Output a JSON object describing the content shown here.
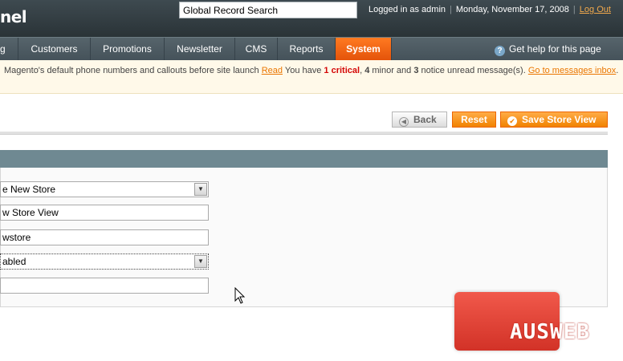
{
  "header": {
    "logo_fragment": "nel",
    "search_value": "Global Record Search",
    "logged_in": "Logged in as admin",
    "date": "Monday, November 17, 2008",
    "logout": "Log Out"
  },
  "nav": {
    "items": [
      {
        "label": "g"
      },
      {
        "label": "Customers"
      },
      {
        "label": "Promotions"
      },
      {
        "label": "Newsletter"
      },
      {
        "label": "CMS"
      },
      {
        "label": "Reports"
      },
      {
        "label": "System",
        "active": true
      }
    ],
    "help": "Get help for this page"
  },
  "notice": {
    "text1": "Magento's default phone numbers and callouts before site launch",
    "read": "Read",
    "text2": "You have",
    "critical": "1 critical",
    "text3": ",",
    "minor_count": "4",
    "text4": "minor and",
    "notice_count": "3",
    "text5": "notice unread message(s).",
    "goto": "Go to messages inbox",
    "end": "."
  },
  "buttons": {
    "back": "Back",
    "reset": "Reset",
    "save": "Save Store View"
  },
  "form": {
    "store": "e New Store",
    "name": "w Store View",
    "code": "wstore",
    "status": "abled",
    "sort_order": ""
  },
  "watermark": "AUSWEB",
  "colors": {
    "header": "#2a3337",
    "nav": "#45525a",
    "active_tab": "#e4530a",
    "button_orange": "#f18200",
    "section_head": "#6f8992",
    "notice_bg": "#fff9e9",
    "watermark": "#d23227"
  }
}
